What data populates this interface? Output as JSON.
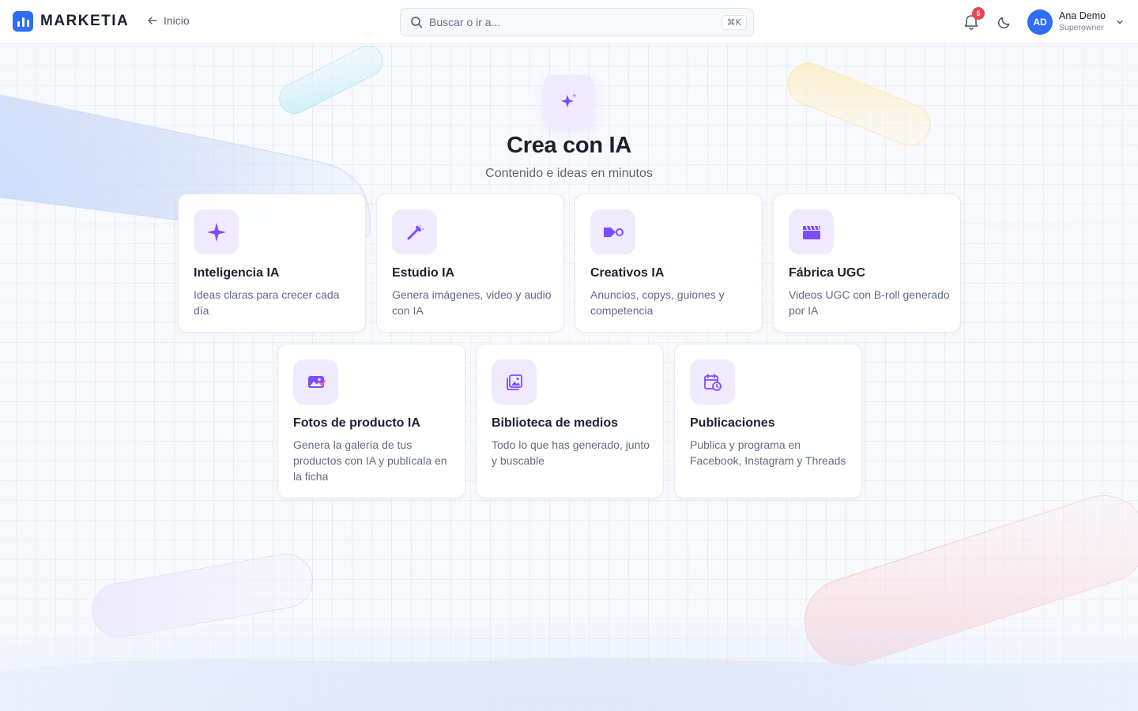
{
  "header": {
    "brand": "MARKETIA",
    "back_label": "Inicio",
    "search": {
      "placeholder": "Buscar o ir a...",
      "shortcut": "⌘K"
    },
    "notifications_count": "5",
    "user": {
      "initials": "AD",
      "name": "Ana Demo",
      "role": "Superowner"
    }
  },
  "hero": {
    "title": "Crea con IA",
    "subtitle": "Contenido e ideas en minutos"
  },
  "cards": [
    {
      "title": "Inteligencia IA",
      "description": "Ideas claras para crecer cada día",
      "icon": "sparkle-icon"
    },
    {
      "title": "Estudio IA",
      "description": "Genera imágenes, video y audio con IA",
      "icon": "magic-wand-icon"
    },
    {
      "title": "Creativos IA",
      "description": "Anuncios, copys, guiones y competencia",
      "icon": "video-camera-icon"
    },
    {
      "title": "Fábrica UGC",
      "description": "Videos UGC con B-roll generado por IA",
      "icon": "clapperboard-icon"
    },
    {
      "title": "Fotos de producto IA",
      "description": "Genera la galería de tus productos con IA y publícala en la ficha",
      "icon": "product-photo-icon"
    },
    {
      "title": "Biblioteca de medios",
      "description": "Todo lo que has generado, junto y buscable",
      "icon": "media-library-icon"
    },
    {
      "title": "Publicaciones",
      "description": "Publica y programa en Facebook, Instagram y Threads",
      "icon": "calendar-clock-icon"
    }
  ],
  "colors": {
    "accent": "#2f6df6",
    "icon_purple": "#7c4dff",
    "icon_bg": "#efeafd",
    "badge_red": "#e5484d"
  }
}
